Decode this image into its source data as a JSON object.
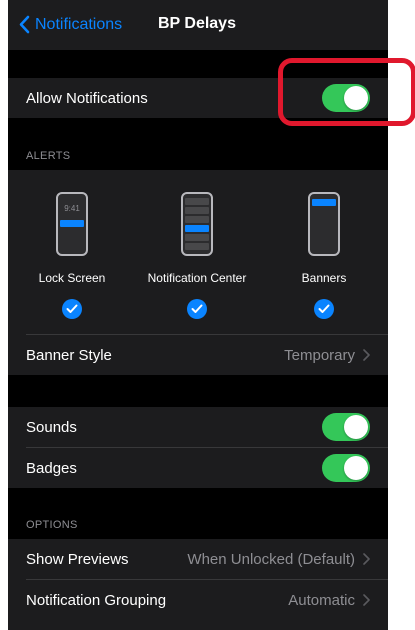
{
  "nav": {
    "back_label": "Notifications",
    "title": "BP Delays"
  },
  "allow": {
    "label": "Allow Notifications",
    "enabled": true
  },
  "alerts": {
    "header": "ALERTS",
    "time_text": "9:41",
    "options": [
      {
        "label": "Lock Screen",
        "checked": true
      },
      {
        "label": "Notification Center",
        "checked": true
      },
      {
        "label": "Banners",
        "checked": true
      }
    ],
    "banner_style": {
      "label": "Banner Style",
      "value": "Temporary"
    }
  },
  "sounds": {
    "label": "Sounds",
    "enabled": true
  },
  "badges": {
    "label": "Badges",
    "enabled": true
  },
  "options": {
    "header": "OPTIONS",
    "show_previews": {
      "label": "Show Previews",
      "value": "When Unlocked (Default)"
    },
    "grouping": {
      "label": "Notification Grouping",
      "value": "Automatic"
    }
  },
  "colors": {
    "accent": "#0a84ff",
    "toggle_on": "#34c759",
    "highlight": "#e0182d"
  }
}
